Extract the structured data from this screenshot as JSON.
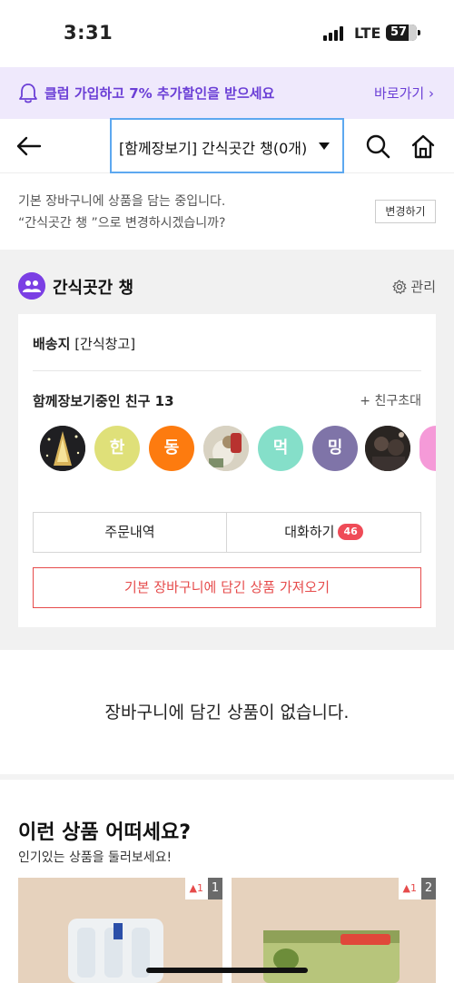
{
  "status_bar": {
    "time": "3:31",
    "network": "LTE",
    "battery": "57"
  },
  "promo": {
    "text": "클럽 가입하고 7% 추가할인을 받으세요",
    "link": "바로가기 ›"
  },
  "nav": {
    "cart_select": "[함께장보기] 간식곳간 챙(0개)"
  },
  "notice": {
    "line1": "기본 장바구니에 상품을 담는 중입니다.",
    "line2": "“간식곳간 챙 ”으로 변경하시겠습니까?",
    "change_button": "변경하기"
  },
  "group": {
    "name": "간식곳간 챙",
    "manage": "관리",
    "shipping_label": "배송지",
    "shipping_value": "[간식창고]",
    "friends_title": "함께장보기중인 친구 13",
    "invite": "친구초대",
    "friends": [
      {
        "initial": "",
        "color": "#3a3a3a",
        "photo": "tree"
      },
      {
        "initial": "한",
        "color": "#dfe079"
      },
      {
        "initial": "동",
        "color": "#fd7b0f"
      },
      {
        "initial": "",
        "color": "#cfc7b5",
        "photo": "cat"
      },
      {
        "initial": "먹",
        "color": "#85dfc9"
      },
      {
        "initial": "밍",
        "color": "#7f74a8"
      },
      {
        "initial": "",
        "color": "#2e2a28",
        "photo": "dark"
      },
      {
        "initial": "",
        "color": "#f59ad8"
      }
    ],
    "order_button": "주문내역",
    "chat_button": "대화하기",
    "chat_badge": "46",
    "import_button": "기본 장바구니에 담긴 상품 가져오기"
  },
  "empty": {
    "message": "장바구니에 담긴 상품이 없습니다."
  },
  "reco": {
    "title": "이런 상품 어떠세요?",
    "subtitle": "인기있는 상품을 둘러보세요!",
    "products": [
      {
        "rank": "1",
        "change": "▲1"
      },
      {
        "rank": "2",
        "change": "▲1"
      }
    ]
  },
  "colors": {
    "accent": "#6b3fd6",
    "promo_bg": "#efe9fc",
    "red": "#e64b4b",
    "select_border": "#5da8f0"
  }
}
